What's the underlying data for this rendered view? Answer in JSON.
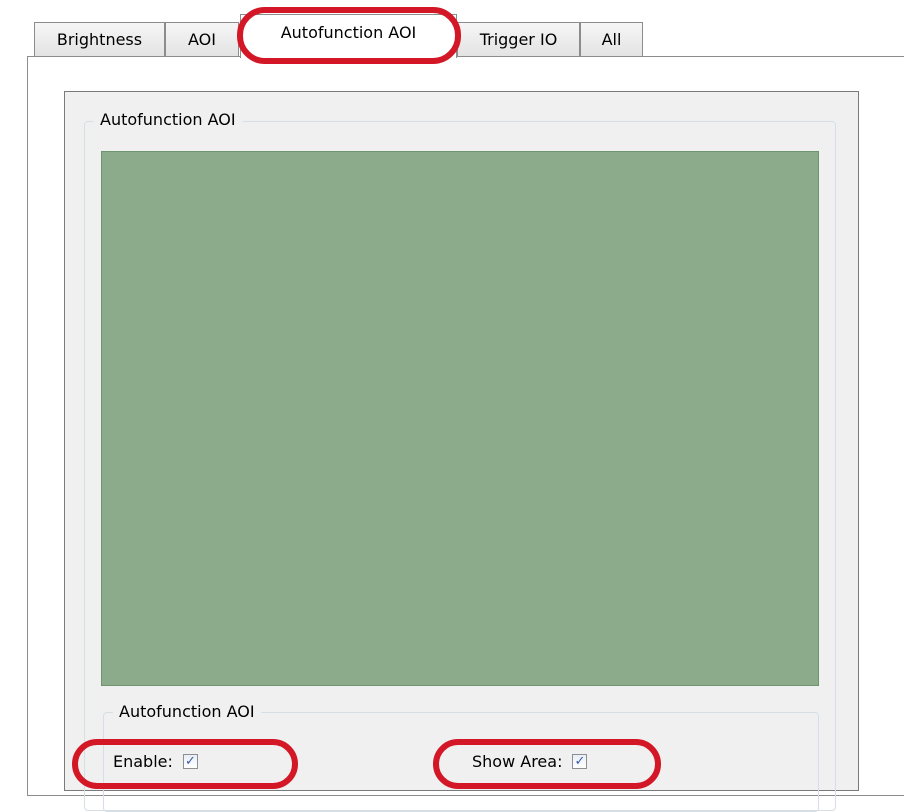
{
  "tabs": [
    {
      "label": "Brightness"
    },
    {
      "label": "AOI"
    },
    {
      "label": "Autofunction AOI"
    },
    {
      "label": "Trigger IO"
    },
    {
      "label": "All"
    }
  ],
  "group": {
    "title": "Autofunction AOI"
  },
  "settings": {
    "title": "Autofunction AOI",
    "enable_label": "Enable:",
    "enable_checked": true,
    "show_area_label": "Show Area:",
    "show_area_checked": true,
    "check_glyph": "✓"
  },
  "colors": {
    "preview_area": "#8cab8a",
    "highlight": "#d31726"
  }
}
